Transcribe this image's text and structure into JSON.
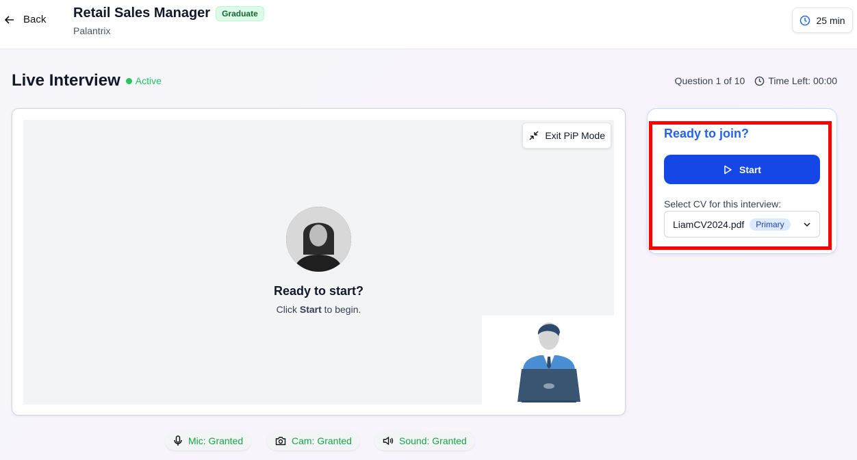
{
  "header": {
    "back_label": "Back",
    "job_title": "Retail Sales Manager",
    "level_badge": "Graduate",
    "company": "Palantrix",
    "duration": "25 min"
  },
  "interview": {
    "title": "Live Interview",
    "status": "Active",
    "question_progress": "Question 1 of 10",
    "time_left": "Time Left: 00:00"
  },
  "video": {
    "exit_pip_label": "Exit PiP Mode",
    "ready_title": "Ready to start?",
    "ready_prefix": "Click ",
    "ready_bold": "Start",
    "ready_suffix": " to begin."
  },
  "join_panel": {
    "title": "Ready to join?",
    "start_label": "Start",
    "cv_label": "Select CV for this interview:",
    "cv_selected": "LiamCV2024.pdf",
    "cv_badge": "Primary"
  },
  "permissions": [
    {
      "label": "Mic: Granted",
      "icon": "mic-icon"
    },
    {
      "label": "Cam: Granted",
      "icon": "camera-icon"
    },
    {
      "label": "Sound: Granted",
      "icon": "speaker-icon"
    }
  ],
  "colors": {
    "accent": "#1447e6",
    "success": "#22c55e",
    "highlight": "#ff0000"
  }
}
